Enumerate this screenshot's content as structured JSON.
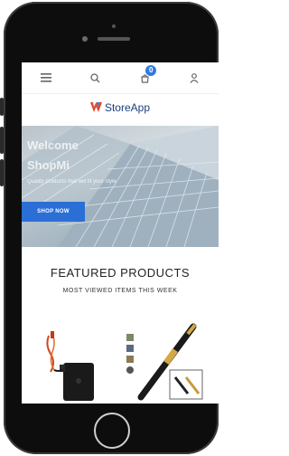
{
  "header": {
    "cart_count": "0",
    "icons": [
      "menu-icon",
      "search-icon",
      "cart-icon",
      "user-icon"
    ]
  },
  "logo": {
    "text": "StoreApp"
  },
  "hero": {
    "title": "Welcome",
    "subtitle": "ShopMi",
    "small": "Quality products that will fit your style",
    "button_label": "SHOP NOW"
  },
  "featured": {
    "title": "FEATURED PRODUCTS",
    "subtitle": "MOST VIEWED ITEMS THIS WEEK"
  },
  "colors": {
    "accent": "#2b6fd6",
    "logo": "#1c3f7a"
  }
}
